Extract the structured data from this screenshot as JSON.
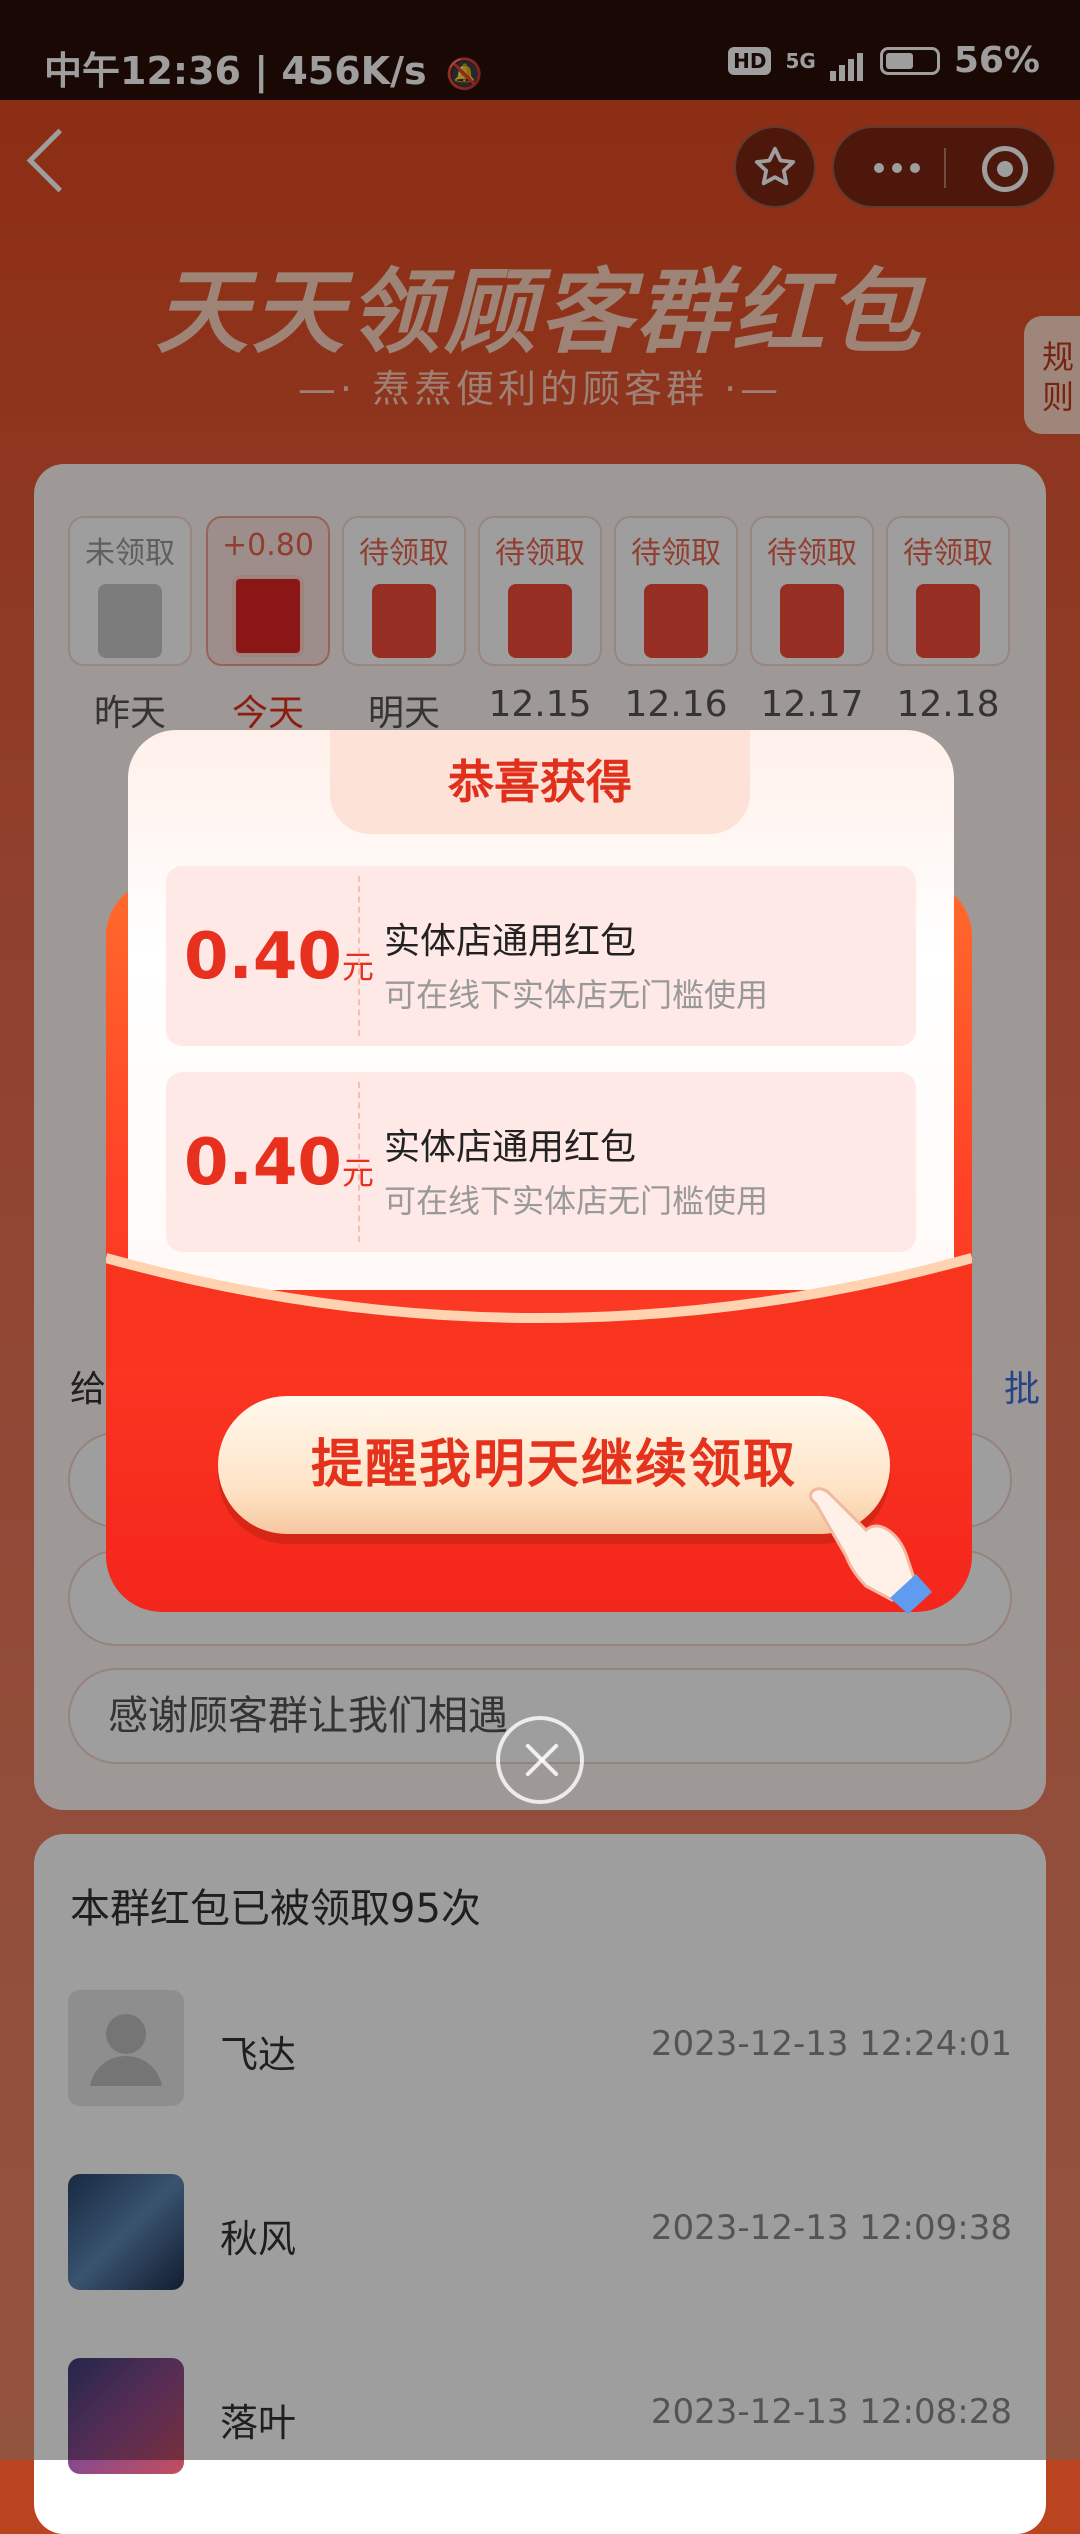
{
  "status_bar": {
    "time": "中午12:36",
    "speed": "456K/s",
    "hd": "HD",
    "network": "5G",
    "battery_percent": "56%",
    "battery_level": 0.56
  },
  "header": {
    "title": "天天领顾客群红包",
    "subtitle": "—·  焘焘便利的顾客群  ·—",
    "rules": "规则"
  },
  "calendar": [
    {
      "status": "未领取",
      "label": "昨天"
    },
    {
      "status": "+0.80",
      "label": "今天"
    },
    {
      "status": "待领取",
      "label": "明天"
    },
    {
      "status": "待领取",
      "label": "12.15"
    },
    {
      "status": "待领取",
      "label": "12.16"
    },
    {
      "status": "待领取",
      "label": "12.17"
    },
    {
      "status": "待领取",
      "label": "12.18"
    }
  ],
  "message_section": {
    "label": "给",
    "more": "批",
    "option_last": "感谢顾客群让我们相遇"
  },
  "records": {
    "count_label": "本群红包已被领取95次",
    "items": [
      {
        "name": "飞达",
        "time": "2023-12-13 12:24:01"
      },
      {
        "name": "秋风",
        "time": "2023-12-13 12:09:38"
      },
      {
        "name": "落叶",
        "time": "2023-12-13 12:08:28"
      }
    ]
  },
  "modal": {
    "title": "恭喜获得",
    "coupons": [
      {
        "amount": "0.40",
        "unit": "元",
        "title": "实体店通用红包",
        "desc": "可在线下实体店无门槛使用"
      },
      {
        "amount": "0.40",
        "unit": "元",
        "title": "实体店通用红包",
        "desc": "可在线下实体店无门槛使用"
      }
    ],
    "cta": "提醒我明天继续领取"
  },
  "colors": {
    "accent_red": "#e5321c",
    "background_orange": "#e5512a",
    "link_blue": "#3a6fd8"
  }
}
